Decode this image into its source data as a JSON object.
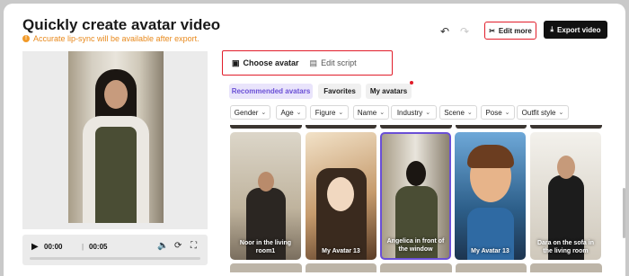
{
  "header": {
    "title": "Quickly create avatar video",
    "notice": "Accurate lip-sync will be available after export.",
    "edit_more_label": "Edit more",
    "export_label": "Export video"
  },
  "player": {
    "current_time": "00:00",
    "duration": "00:05",
    "progress": 0
  },
  "tabs": [
    {
      "label": "Choose avatar",
      "active": true
    },
    {
      "label": "Edit script",
      "active": false
    }
  ],
  "categories": [
    {
      "label": "Recommended avatars",
      "active": true
    },
    {
      "label": "Favorites",
      "active": false
    },
    {
      "label": "My avatars",
      "active": false,
      "new_dot": true
    }
  ],
  "filters": [
    "Gender",
    "Age",
    "Figure",
    "Name",
    "Industry",
    "Scene",
    "Pose",
    "Outfit style"
  ],
  "avatars": [
    {
      "caption": "Noor in the living room1",
      "selected": false
    },
    {
      "caption": "My Avatar 13",
      "selected": false
    },
    {
      "caption": "Angelica in front of the window",
      "selected": true
    },
    {
      "caption": "My Avatar 13",
      "selected": false
    },
    {
      "caption": "Dara on the sofa in the living room",
      "selected": false
    }
  ],
  "colors": {
    "accent": "#6a4fd6",
    "highlight_border": "#e11d2a",
    "notice": "#e8891c",
    "export_bg": "#111111"
  },
  "icons": {
    "undo": "undo-icon",
    "redo": "redo-icon",
    "edit_more": "scissors-icon",
    "export": "download-icon",
    "play": "play-icon",
    "volume": "volume-icon",
    "speed": "speed-icon",
    "fullscreen": "fullscreen-icon"
  }
}
